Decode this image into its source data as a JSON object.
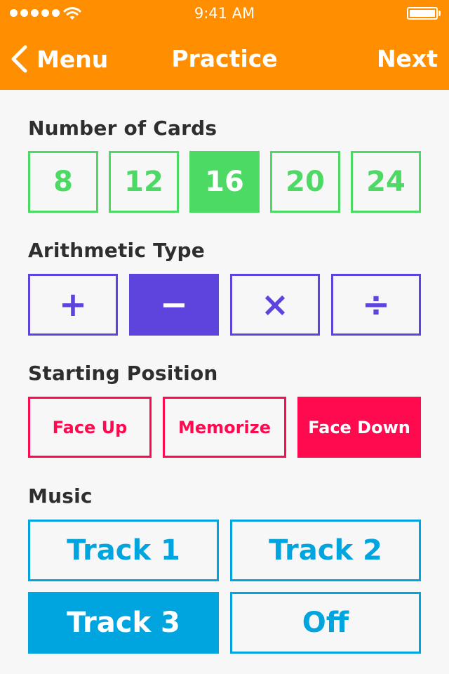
{
  "status_bar": {
    "time": "9:41 AM",
    "signal_icon": "signal-dots-icon",
    "wifi_icon": "wifi-icon",
    "battery_icon": "battery-icon"
  },
  "nav": {
    "back_label": "Menu",
    "back_icon": "chevron-left-icon",
    "title": "Practice",
    "next_label": "Next"
  },
  "sections": {
    "cards": {
      "title": "Number of Cards",
      "options": [
        "8",
        "12",
        "16",
        "20",
        "24"
      ],
      "selected": "16",
      "color": "#4cd964"
    },
    "arithmetic": {
      "title": "Arithmetic Type",
      "options": [
        "+",
        "−",
        "×",
        "÷"
      ],
      "selected": "−",
      "color": "#5e44dd"
    },
    "position": {
      "title": "Starting Position",
      "options": [
        "Face Up",
        "Memorize",
        "Face Down"
      ],
      "selected": "Face Down",
      "color": "#ff0a4e"
    },
    "music": {
      "title": "Music",
      "options": [
        "Track 1",
        "Track 2",
        "Track 3",
        "Off"
      ],
      "selected": "Track 3",
      "color": "#00a5e0"
    }
  },
  "colors": {
    "header": "#ff8e00",
    "background": "#f7f7f7",
    "text": "#2e2e2e"
  }
}
